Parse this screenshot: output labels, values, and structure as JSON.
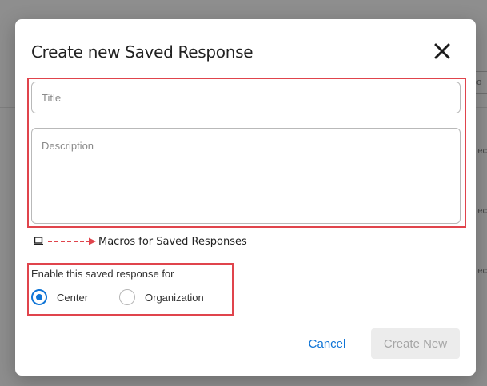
{
  "background": {
    "fragments": [
      "po",
      "ec",
      "ec",
      "ec"
    ]
  },
  "dialog": {
    "title": "Create new Saved Response",
    "close_icon": "close-icon",
    "fields": {
      "title_placeholder": "Title",
      "title_value": "",
      "description_placeholder": "Description",
      "description_value": ""
    },
    "macros": {
      "icon": "laptop-icon",
      "label": "Macros for Saved Responses"
    },
    "enable": {
      "label": "Enable this saved response for",
      "options": [
        {
          "label": "Center",
          "selected": true
        },
        {
          "label": "Organization",
          "selected": false
        }
      ]
    },
    "buttons": {
      "cancel": "Cancel",
      "create": "Create New"
    }
  },
  "colors": {
    "accent": "#0e74d6",
    "annotation": "#e0444c",
    "disabled_bg": "#ececec",
    "disabled_text": "#a6a6a6"
  }
}
